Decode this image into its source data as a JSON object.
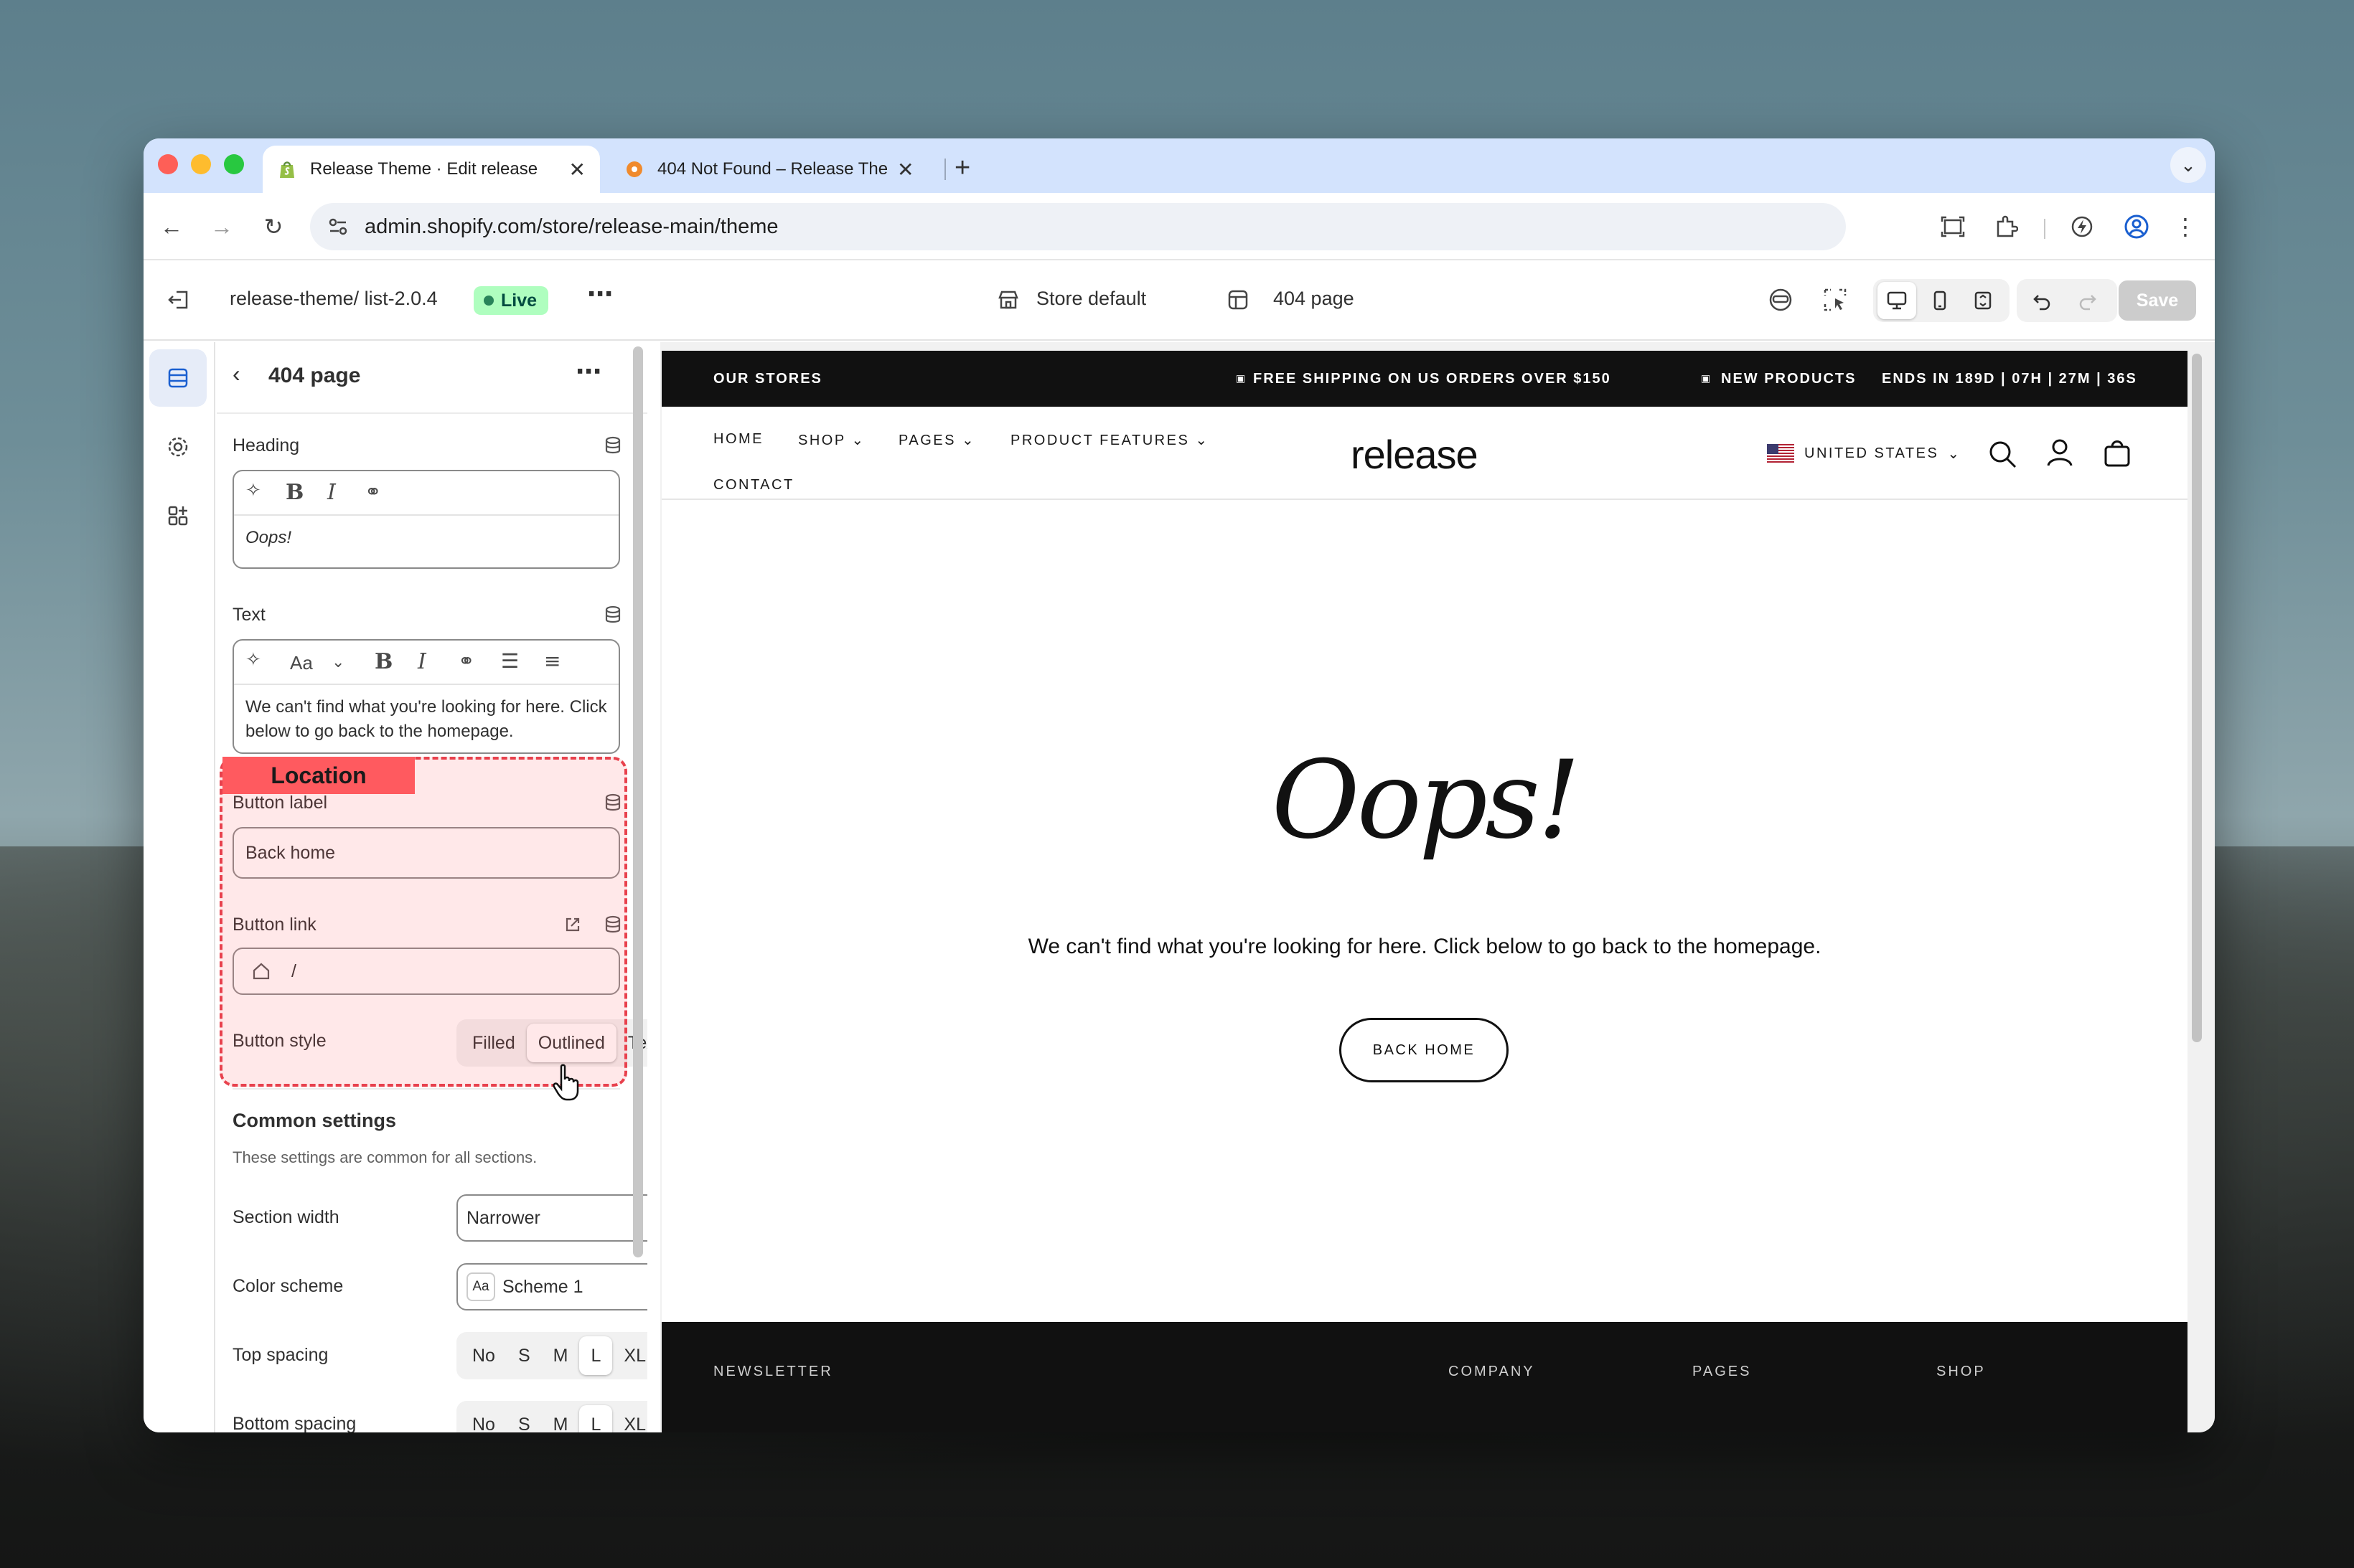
{
  "browser": {
    "tabs": [
      {
        "title": "Release Theme · Edit release",
        "active": true
      },
      {
        "title": "404 Not Found – Release The",
        "active": false
      }
    ],
    "url": "admin.shopify.com/store/release-main/theme"
  },
  "editor": {
    "theme_name": "release-theme/ list-2.0.4",
    "live_label": "Live",
    "store_label": "Store default",
    "template_label": "404 page",
    "save_label": "Save"
  },
  "panel": {
    "title": "404 page",
    "heading_label": "Heading",
    "heading_value": "Oops!",
    "text_label": "Text",
    "text_value": "We can't find what you're looking for here. Click below to go back to the homepage.",
    "text_style_label": "Aa",
    "location_tag": "Location",
    "button_label_label": "Button label",
    "button_label_value": "Back home",
    "button_link_label": "Button link",
    "button_link_value": "/",
    "button_style_label": "Button style",
    "button_style_options": [
      "Filled",
      "Outlined",
      "Text"
    ],
    "button_style_selected": "Outlined",
    "common_title": "Common settings",
    "common_desc": "These settings are common for all sections.",
    "section_width_label": "Section width",
    "section_width_value": "Narrower",
    "color_scheme_label": "Color scheme",
    "color_scheme_value": "Scheme 1",
    "color_scheme_icon_text": "Aa",
    "top_spacing_label": "Top spacing",
    "spacing_options": [
      "No",
      "S",
      "M",
      "L",
      "XL"
    ],
    "top_spacing_selected": "L",
    "bottom_spacing_label": "Bottom spacing"
  },
  "preview": {
    "announce_left": "OUR STORES",
    "announce_center": "FREE SHIPPING ON US ORDERS OVER $150",
    "announce_new": "NEW PRODUCTS",
    "announce_timer": "ENDS IN 189D | 07H | 27M | 36S",
    "nav": [
      "HOME",
      "SHOP",
      "PAGES",
      "PRODUCT FEATURES",
      "CONTACT"
    ],
    "logo": "release",
    "country": "UNITED STATES",
    "heading": "Oops!",
    "message": "We can't find what you're looking for here. Click below to go back to the homepage.",
    "button": "BACK HOME",
    "footer": [
      "NEWSLETTER",
      "COMPANY",
      "PAGES",
      "SHOP"
    ]
  },
  "colors": {
    "live_bg": "#affebf",
    "location_red": "#ff5a5f",
    "tab_strip": "#d3e3fd"
  }
}
